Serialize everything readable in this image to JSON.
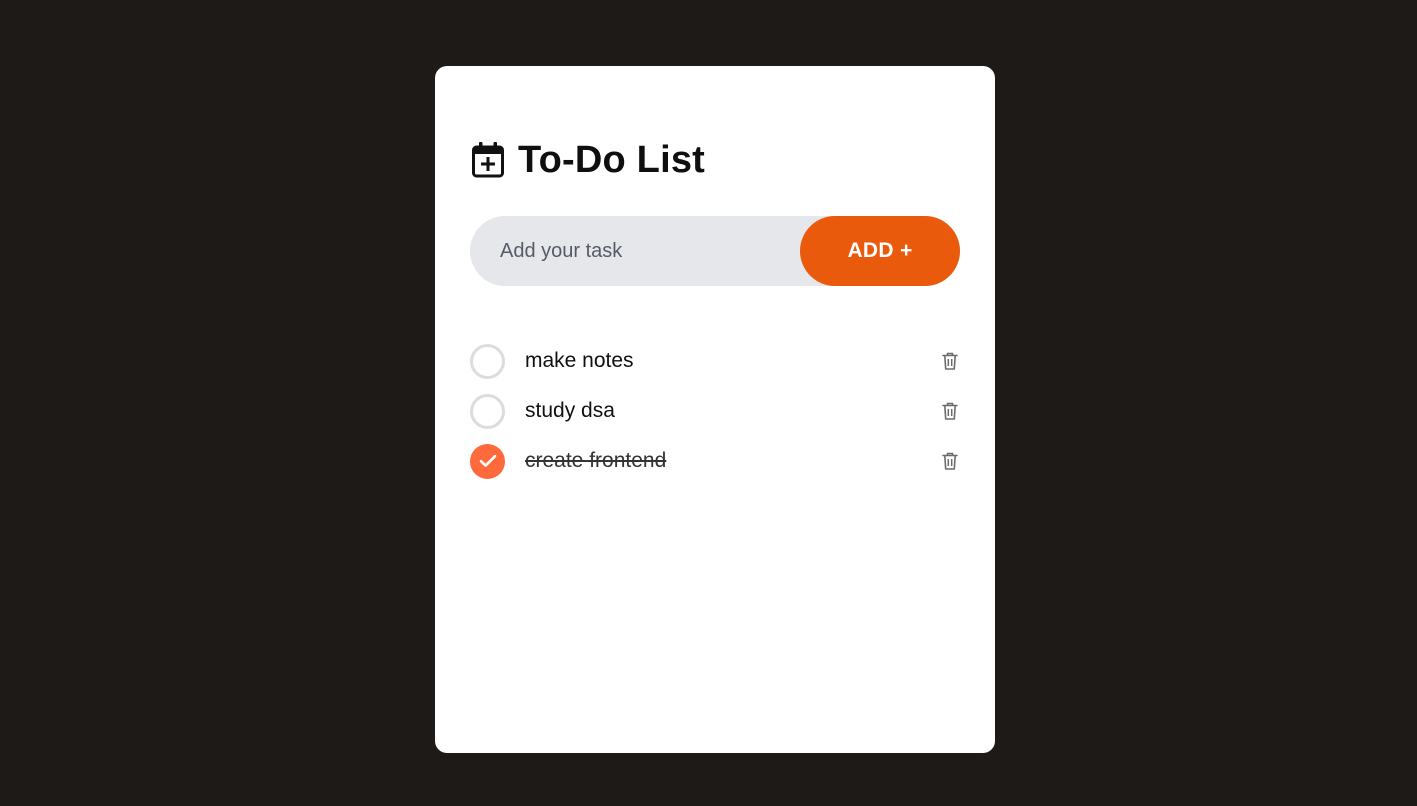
{
  "app": {
    "title": "To-Do List",
    "title_icon": "calendar-plus-icon"
  },
  "form": {
    "placeholder": "Add your task",
    "value": "",
    "add_label": "ADD +"
  },
  "colors": {
    "page_background": "#1e1a17",
    "card_background": "#ffffff",
    "accent": "#ea5a0c",
    "checked": "#ff6a3d",
    "input_background": "#e6e7eb"
  },
  "tasks": [
    {
      "text": "make notes",
      "done": false,
      "delete_icon": "trash-icon"
    },
    {
      "text": "study dsa",
      "done": false,
      "delete_icon": "trash-icon"
    },
    {
      "text": "create frontend",
      "done": true,
      "delete_icon": "trash-icon"
    }
  ]
}
